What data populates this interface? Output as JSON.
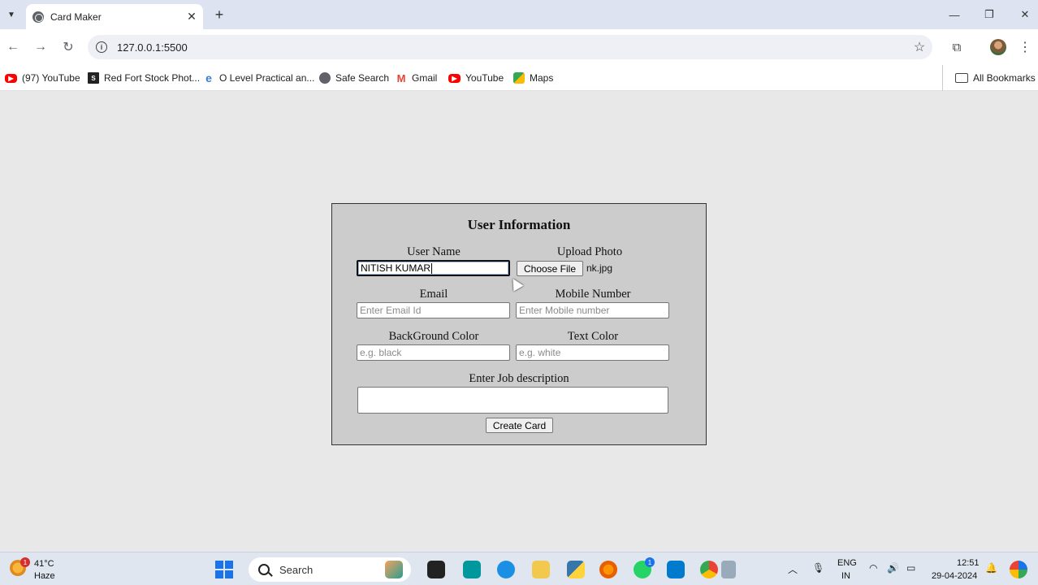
{
  "browser": {
    "tab_title": "Card Maker",
    "url": "127.0.0.1:5500",
    "bookmarks": [
      {
        "label": "(97) YouTube",
        "icon": "youtube-icon"
      },
      {
        "label": "Red Fort Stock Phot...",
        "icon": "stock-photo-icon"
      },
      {
        "label": "O Level Practical an...",
        "icon": "edge-icon"
      },
      {
        "label": "Safe Search",
        "icon": "globe-icon"
      },
      {
        "label": "Gmail",
        "icon": "gmail-icon"
      },
      {
        "label": "YouTube",
        "icon": "youtube-icon"
      },
      {
        "label": "Maps",
        "icon": "maps-icon"
      }
    ],
    "all_bookmarks": "All Bookmarks"
  },
  "form": {
    "title": "User Information",
    "user_name": {
      "label": "User Name",
      "value": "NITISH KUMAR"
    },
    "photo": {
      "label": "Upload Photo",
      "button": "Choose File",
      "file_name": "nk.jpg"
    },
    "email": {
      "label": "Email",
      "placeholder": "Enter Email Id"
    },
    "mobile": {
      "label": "Mobile Number",
      "placeholder": "Enter Mobile number"
    },
    "bg_color": {
      "label": "BackGround Color",
      "placeholder": "e.g. black"
    },
    "text_color": {
      "label": "Text Color",
      "placeholder": "e.g. white"
    },
    "job": {
      "label": "Enter Job description"
    },
    "submit": "Create Card"
  },
  "taskbar": {
    "weather": {
      "temp": "41°C",
      "desc": "Haze",
      "badge": "1"
    },
    "search_label": "Search",
    "whatsapp_badge": "1",
    "lang_top": "ENG",
    "lang_bottom": "IN",
    "time": "12:51",
    "date": "29-04-2024"
  },
  "colors": {
    "page_bg": "#e8e8e8",
    "form_bg": "#cccccc",
    "tabstrip_bg": "#dde3f0",
    "taskbar_bg": "#dfe6f0"
  }
}
